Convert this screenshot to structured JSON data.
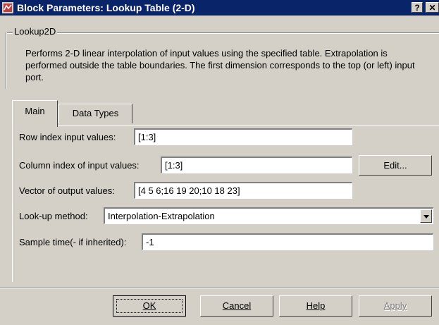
{
  "window": {
    "title": "Block Parameters: Lookup Table (2-D)",
    "help_button": "?",
    "close_button": "✕",
    "app_icon": "simulink-block-icon"
  },
  "group": {
    "label": "Lookup2D",
    "description": "Performs 2-D linear interpolation of input values using the specified table.  Extrapolation is performed outside the table boundaries.  The first dimension corresponds to the top (or left) input port."
  },
  "tabs": [
    {
      "label": "Main",
      "active": true
    },
    {
      "label": "Data Types",
      "active": false
    }
  ],
  "params": {
    "row_index": {
      "label": "Row index input values:",
      "value": "[1:3]"
    },
    "col_index": {
      "label": "Column index of input values:",
      "value": "[1:3]",
      "edit_button": "Edit..."
    },
    "output": {
      "label": "Vector of output values:",
      "value": "[4 5 6;16 19 20;10 18 23]"
    },
    "lookup_method": {
      "label": "Look-up method:",
      "value": "Interpolation-Extrapolation"
    },
    "sample_time": {
      "label": "Sample time(- if inherited):",
      "value": "-1"
    }
  },
  "buttons": {
    "ok": "OK",
    "cancel": "Cancel",
    "help": "Help",
    "apply": "Apply"
  }
}
